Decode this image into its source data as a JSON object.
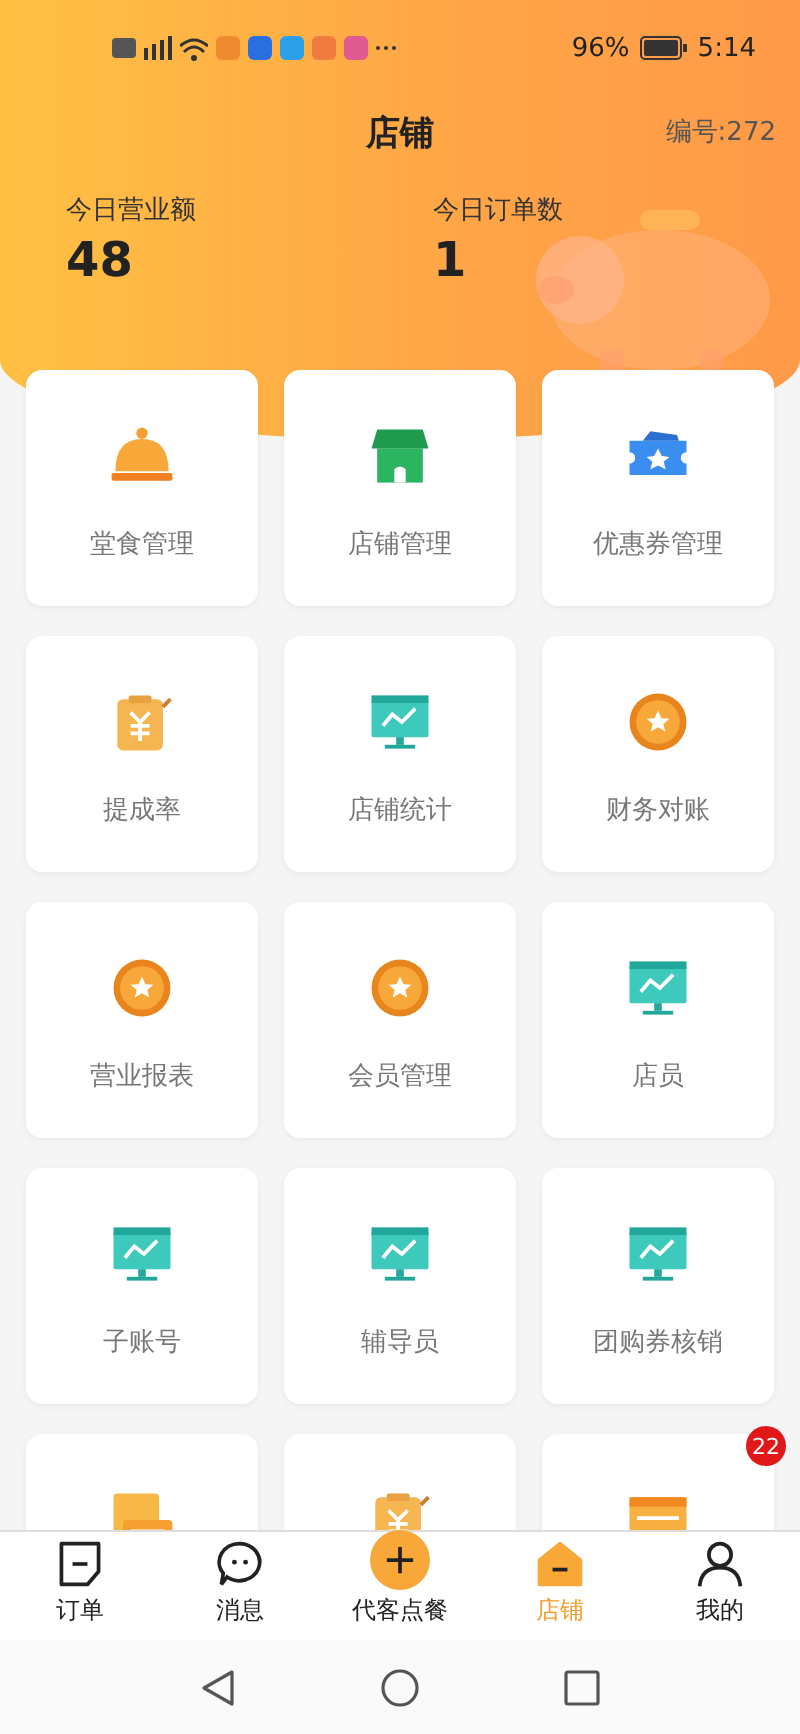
{
  "status_bar": {
    "battery": "96%",
    "time": "5:14"
  },
  "header": {
    "title": "店铺",
    "store_no": "编号:272"
  },
  "stats": [
    {
      "label": "今日营业额",
      "value": "48"
    },
    {
      "label": "今日订单数",
      "value": "1"
    }
  ],
  "grid": [
    {
      "kind": "cloche",
      "label": "堂食管理"
    },
    {
      "kind": "shop",
      "label": "店铺管理"
    },
    {
      "kind": "ticket",
      "label": "优惠券管理"
    },
    {
      "kind": "yuan-clipboard",
      "label": "提成率"
    },
    {
      "kind": "monitor",
      "label": "店铺统计"
    },
    {
      "kind": "coin",
      "label": "财务对账"
    },
    {
      "kind": "coin",
      "label": "营业报表"
    },
    {
      "kind": "coin",
      "label": "会员管理"
    },
    {
      "kind": "monitor",
      "label": "店员"
    },
    {
      "kind": "monitor",
      "label": "子账号"
    },
    {
      "kind": "monitor",
      "label": "辅导员"
    },
    {
      "kind": "monitor",
      "label": "团购券核销"
    },
    {
      "kind": "yuan-card"
    },
    {
      "kind": "yuan-clipboard"
    },
    {
      "kind": "card",
      "badge": "22"
    }
  ],
  "tabs": [
    {
      "kind": "order",
      "label": "订单",
      "selected": false
    },
    {
      "kind": "message",
      "label": "消息",
      "selected": false
    },
    {
      "kind": "plus",
      "label": "代客点餐",
      "selected": false
    },
    {
      "kind": "shop",
      "label": "店铺",
      "selected": true
    },
    {
      "kind": "person",
      "label": "我的",
      "selected": false
    }
  ]
}
